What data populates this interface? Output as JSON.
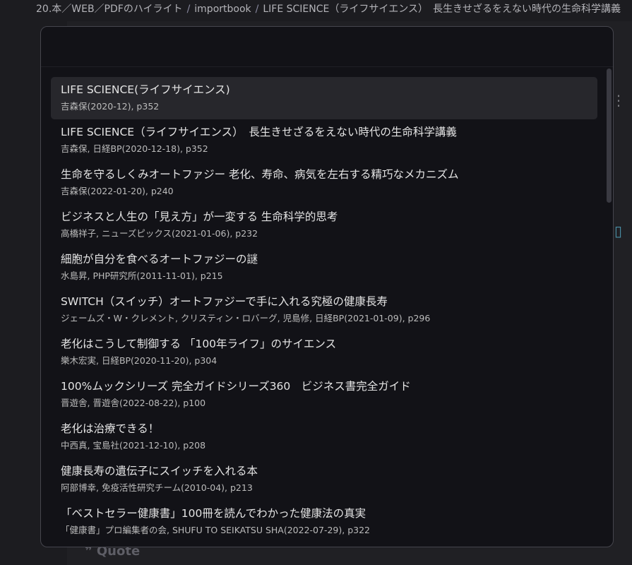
{
  "breadcrumb": {
    "items": [
      "20.本／WEB／PDFのハイライト",
      "importbook",
      "LIFE SCIENCE（ライフサイエンス）　長生きせざるをえない時代の生命科学講義"
    ],
    "separator": "/"
  },
  "background": {
    "quote_label": "Quote",
    "quote_icon": "quote-icon"
  },
  "search": {
    "value": "",
    "placeholder": ""
  },
  "results": [
    {
      "title": "LIFE SCIENCE(ライフサイエンス)",
      "subtitle": "吉森保(2020-12), p352",
      "selected": true
    },
    {
      "title": "LIFE SCIENCE（ライフサイエンス）　長生きせざるをえない時代の生命科学講義",
      "subtitle": "吉森保, 日経BP(2020-12-18), p352"
    },
    {
      "title": "生命を守るしくみオートファジー 老化、寿命、病気を左右する精巧なメカニズム",
      "subtitle": "吉森保(2022-01-20), p240"
    },
    {
      "title": "ビジネスと人生の「見え方」が一変する 生命科学的思考",
      "subtitle": "高橋祥子, ニューズピックス(2021-01-06), p232"
    },
    {
      "title": "細胞が自分を食べるオートファジーの謎",
      "subtitle": "水島昇, PHP研究所(2011-11-01), p215"
    },
    {
      "title": "SWITCH（スイッチ）オートファジーで手に入れる究極の健康長寿",
      "subtitle": "ジェームズ・W・クレメント, クリスティン・ロバーグ, 児島修, 日経BP(2021-01-09), p296"
    },
    {
      "title": "老化はこうして制御する 「100年ライフ」のサイエンス",
      "subtitle": "樂木宏実, 日経BP(2020-11-20), p304"
    },
    {
      "title": "100%ムックシリーズ 完全ガイドシリーズ360　ビジネス書完全ガイド",
      "subtitle": "晋遊舎, 晋遊舎(2022-08-22), p100"
    },
    {
      "title": "老化は治療できる！",
      "subtitle": "中西真, 宝島社(2021-12-10), p208"
    },
    {
      "title": "健康長寿の遺伝子にスイッチを入れる本",
      "subtitle": "阿部博幸, 免疫活性研究チーム(2010-04), p213"
    },
    {
      "title": "「ベストセラー健康書」100冊を読んでわかった健康法の真実",
      "subtitle": "「健康書」プロ編集者の会, SHUFU TO SEIKATSU SHA(2022-07-29), p322"
    }
  ]
}
